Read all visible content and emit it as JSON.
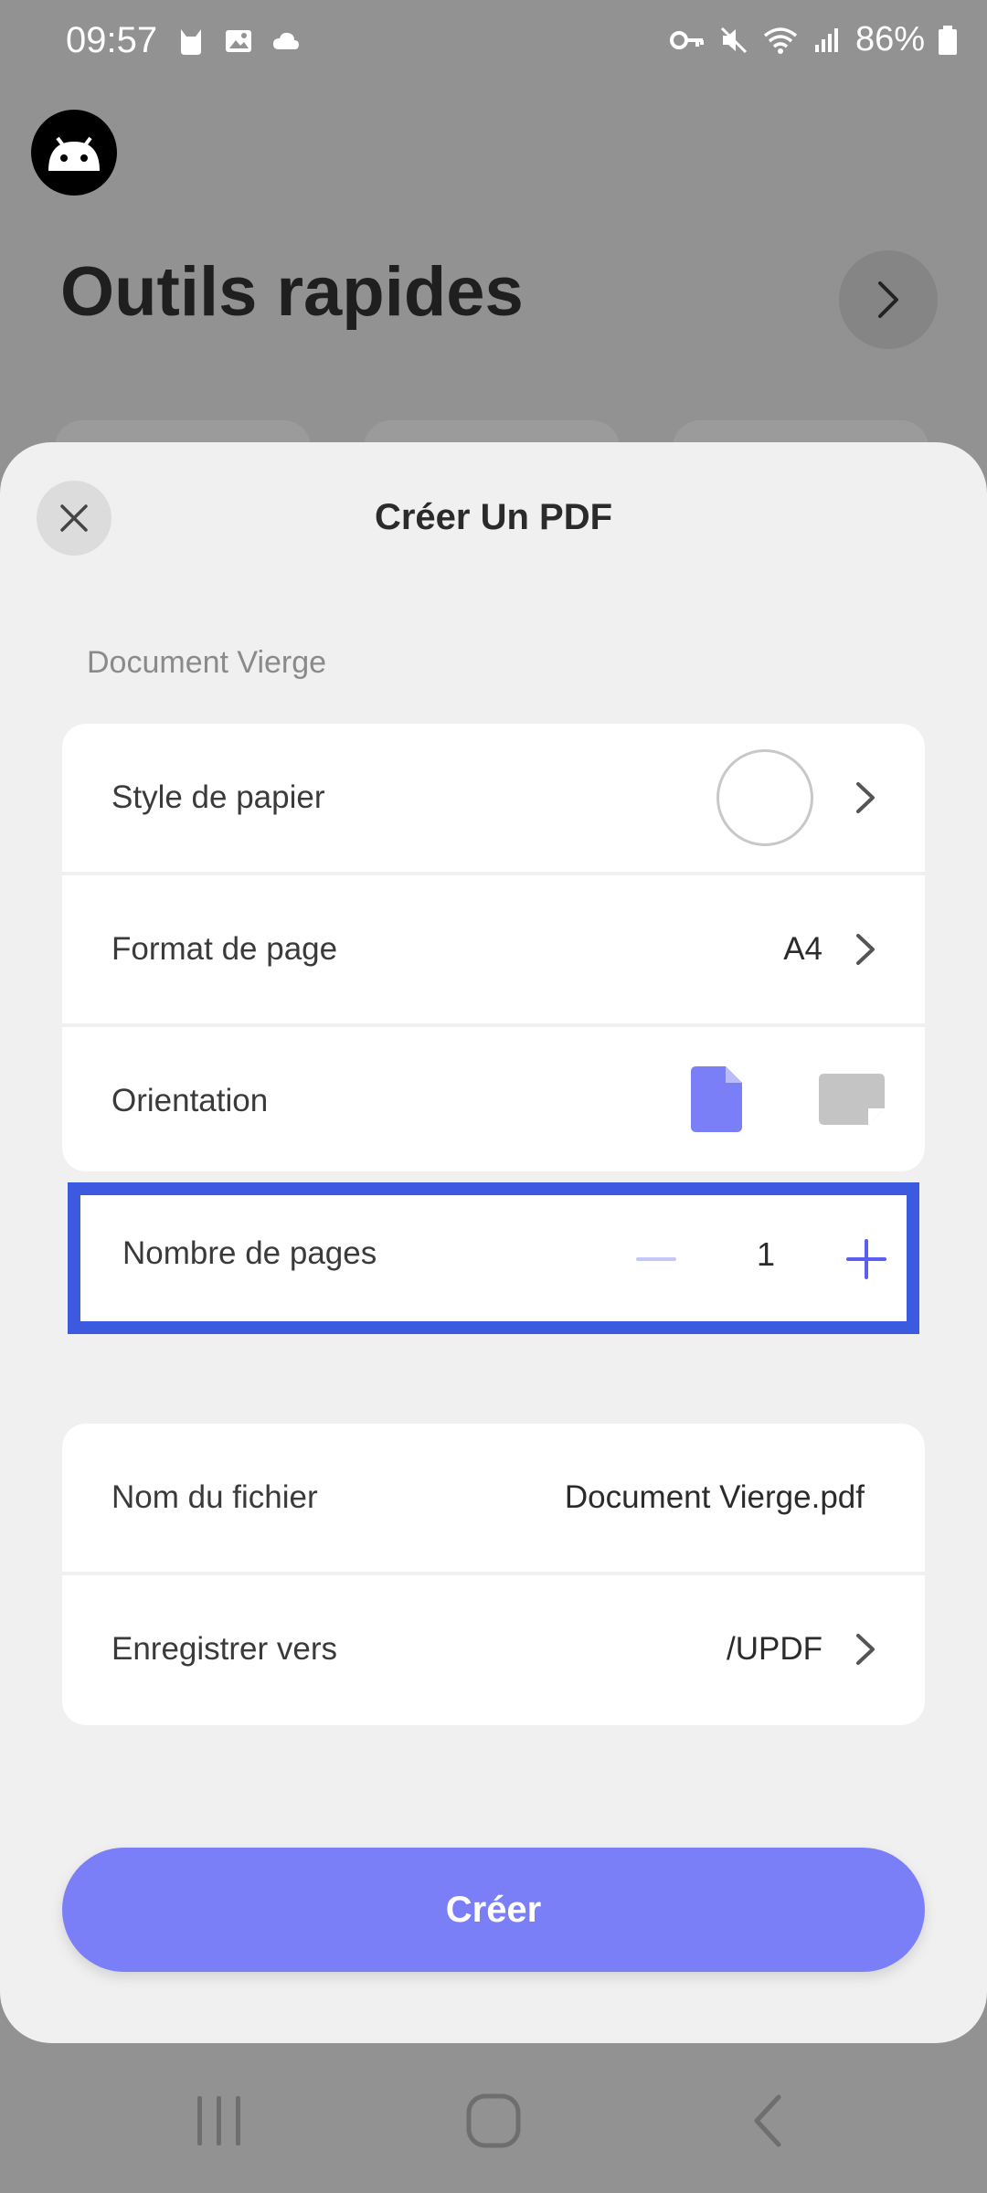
{
  "status_bar": {
    "time": "09:57",
    "battery": "86%"
  },
  "background": {
    "title": "Outils rapides"
  },
  "sheet": {
    "title": "Créer Un PDF",
    "section_label": "Document Vierge",
    "paper_style": {
      "label": "Style de papier"
    },
    "page_format": {
      "label": "Format de page",
      "value": "A4"
    },
    "orientation": {
      "label": "Orientation",
      "selected": "portrait"
    },
    "page_count": {
      "label": "Nombre de pages",
      "value": "1"
    },
    "file_name": {
      "label": "Nom du fichier",
      "value": "Document Vierge.pdf"
    },
    "save_to": {
      "label": "Enregistrer vers",
      "value": "/UPDF"
    },
    "create_button": "Créer"
  },
  "colors": {
    "accent": "#7b7ff7",
    "highlight_border": "#3b5ae0",
    "sheet_bg": "#f0f0f0",
    "scrim": "#929292"
  }
}
